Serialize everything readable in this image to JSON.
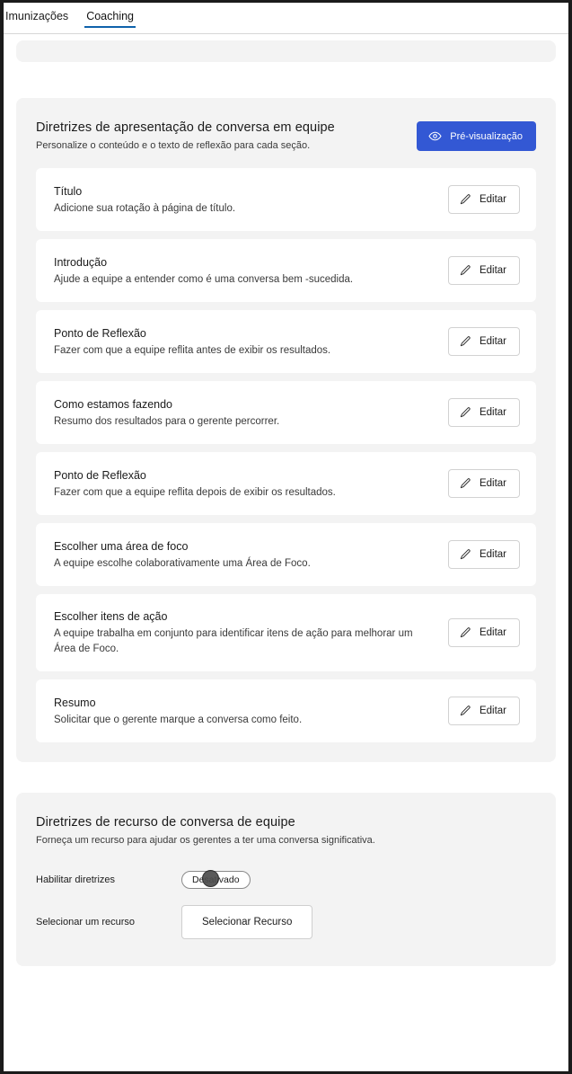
{
  "tabs": [
    {
      "label": "Imunizações",
      "active": false
    },
    {
      "label": "Coaching",
      "active": true
    }
  ],
  "presentation_panel": {
    "title": "Diretrizes de apresentação de conversa em equipe",
    "subtitle": "Personalize o conteúdo e o texto de reflexão para cada seção.",
    "preview_button": "Pré-visualização",
    "preview_icon": "eye-icon",
    "edit_button": "Editar",
    "edit_icon": "pencil-icon",
    "sections": [
      {
        "title": "Título",
        "description": "Adicione sua rotação à página de título."
      },
      {
        "title": "Introdução",
        "description": "Ajude a equipe a entender como é uma conversa bem -sucedida."
      },
      {
        "title": "Ponto de Reflexão",
        "description": "Fazer com que a equipe reflita antes de exibir os resultados."
      },
      {
        "title": "Como estamos fazendo",
        "description": "Resumo dos resultados para o gerente percorrer."
      },
      {
        "title": "Ponto de Reflexão",
        "description": "Fazer com que a equipe reflita depois de exibir os resultados."
      },
      {
        "title": "Escolher uma área de foco",
        "description": "A equipe escolhe colaborativamente uma Área de Foco."
      },
      {
        "title": "Escolher itens de ação",
        "description": "A equipe trabalha em conjunto para identificar itens de ação para melhorar um Área de Foco."
      },
      {
        "title": "Resumo",
        "description": "Solicitar que o gerente marque a conversa como feito."
      }
    ]
  },
  "resource_panel": {
    "title": "Diretrizes de recurso de conversa de equipe",
    "subtitle": "Forneça um recurso para ajudar os gerentes a ter uma conversa significativa.",
    "enable_label": "Habilitar diretrizes",
    "enable_state": "Desativado",
    "select_label": "Selecionar um recurso",
    "select_button": "Selecionar Recurso"
  },
  "colors": {
    "accent_blue": "#3358d4",
    "tab_underline": "#0f62ab",
    "panel_bg": "#f3f3f3",
    "card_bg": "#ffffff",
    "frame": "#1b1b1b"
  }
}
